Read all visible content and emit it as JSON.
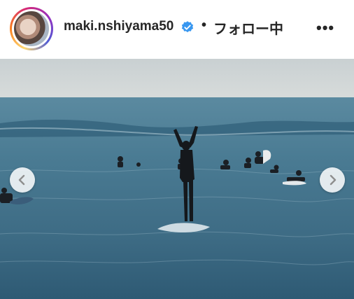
{
  "post_header": {
    "username": "maki.nshiyama50",
    "verified_icon": "verified-badge-icon",
    "separator": "•",
    "follow_status": "フォロー中",
    "more_icon": "more-options-icon",
    "more_label": "•••"
  },
  "carousel": {
    "prev_icon": "chevron-left-icon",
    "next_icon": "chevron-right-icon"
  },
  "colors": {
    "verified_blue": "#3897f0",
    "sky": "#cfd5d6",
    "sea": "#3f6f86"
  }
}
